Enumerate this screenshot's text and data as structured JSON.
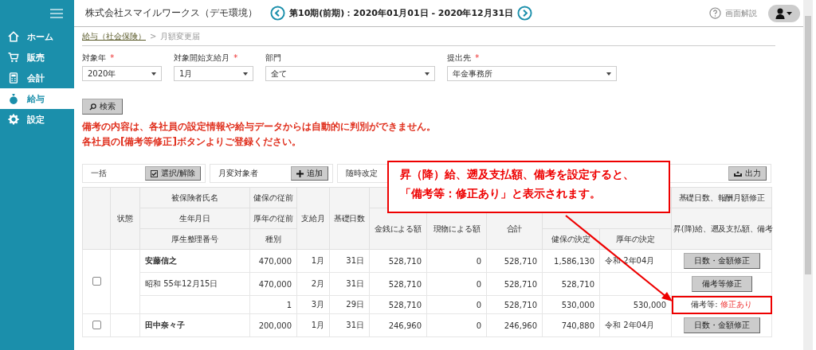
{
  "sidebar": {
    "items": [
      {
        "label": "ホーム",
        "selected": false
      },
      {
        "label": "販売",
        "selected": false
      },
      {
        "label": "会計",
        "selected": false
      },
      {
        "label": "給与",
        "selected": true
      },
      {
        "label": "設定",
        "selected": false
      }
    ]
  },
  "header": {
    "company": "株式会社スマイルワークス（デモ環境）",
    "period": "第10期(前期)：2020年01月01日 - 2020年12月31日",
    "help": "画面解説"
  },
  "breadcrumb": {
    "link": "給与（社会保険）",
    "separator": ">",
    "current": "月額変更届"
  },
  "filters": [
    {
      "label": "対象年",
      "required_mark": "*",
      "value": "2020年"
    },
    {
      "label": "対象開始支給月",
      "required_mark": "*",
      "value": "1月"
    },
    {
      "label": "部門",
      "value": "全て"
    },
    {
      "label": "提出先",
      "required_mark": "*",
      "value": "年金事務所"
    }
  ],
  "search_button": "検索",
  "notice": [
    "備考の内容は、各社員の設定情報や給与データからは自動的に判別ができません。",
    "各社員の[備考等修正]ボタンよりご登録ください。"
  ],
  "toolbar": [
    {
      "label": "一括",
      "button": "選択/解除",
      "kind": "check"
    },
    {
      "label": "月変対象者",
      "button": "追加",
      "kind": "plus"
    },
    {
      "label": "随時改定"
    }
  ],
  "export_button": "出力",
  "callout": [
    "昇（降）給、遡及支払額、備考を設定すると、",
    "「備考等：修正あり」と表示されます。"
  ],
  "table": {
    "head": {
      "state": "状態",
      "name": [
        "被保険者氏名",
        "生年月日",
        "厚生整理番号"
      ],
      "prior": [
        "健保の従前",
        "厚年の従前",
        "種別"
      ],
      "month": "支給月",
      "days": "基礎日数",
      "cash": "金銭による額",
      "in_kind": "現物による額",
      "total": "合計",
      "kenpo_decision": "健保の決定",
      "kounen_decision": "厚年の決定",
      "revision": "基礎日数、報酬月額修正",
      "remarks": "昇(降)給、遡及支払額、備考"
    },
    "employees": [
      {
        "checked": false,
        "lines": [
          {
            "label": "安藤信之",
            "prior": "470,000",
            "month": "1月",
            "days": "31日",
            "cash": "528,710",
            "in_kind": "0",
            "total": "528,710",
            "kenpo": "1,586,130",
            "revision_month": "令和 2年04月",
            "action": {
              "kind": "button",
              "label": "日数・金額修正"
            }
          },
          {
            "label": "昭和 55年12月15日",
            "prior": "470,000",
            "month": "2月",
            "days": "31日",
            "cash": "528,710",
            "in_kind": "0",
            "total": "528,710",
            "kenpo": "528,710",
            "action": {
              "kind": "button",
              "label": "備考等修正"
            }
          },
          {
            "prior": "1",
            "month": "3月",
            "days": "29日",
            "cash": "528,710",
            "in_kind": "0",
            "total": "528,710",
            "kenpo": "530,000",
            "kounen": "530,000",
            "action": {
              "kind": "status",
              "label": "備考等:",
              "value": "修正あり",
              "highlighted": true
            }
          }
        ]
      },
      {
        "checked": false,
        "lines": [
          {
            "label": "田中奈々子",
            "prior": "200,000",
            "month": "1月",
            "days": "31日",
            "cash": "246,960",
            "in_kind": "0",
            "total": "246,960",
            "kenpo": "740,880",
            "revision_month": "令和 2年04月",
            "action": {
              "kind": "button",
              "label": "日数・金額修正"
            }
          }
        ]
      }
    ]
  }
}
